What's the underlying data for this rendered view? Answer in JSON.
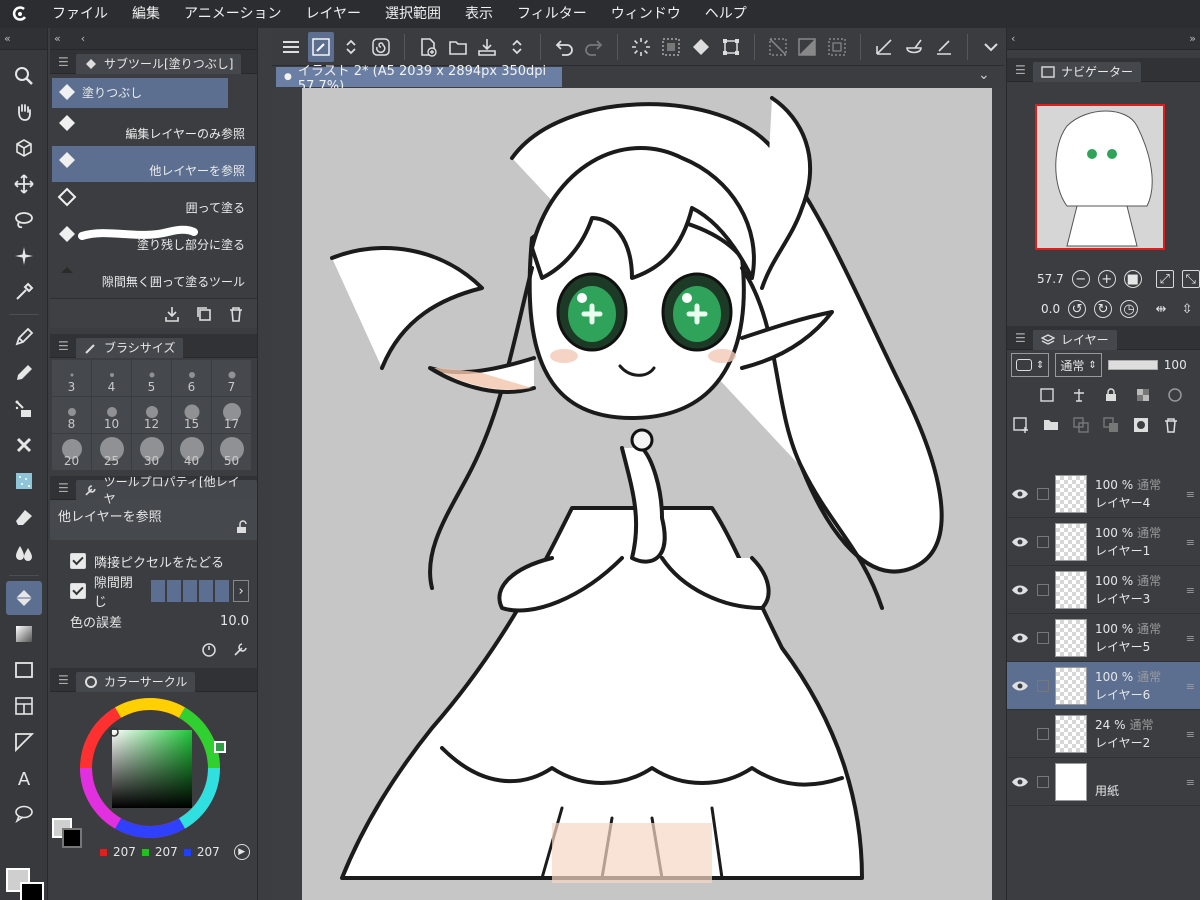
{
  "menu": [
    "ファイル",
    "編集",
    "アニメーション",
    "レイヤー",
    "選択範囲",
    "表示",
    "フィルター",
    "ウィンドウ",
    "ヘルプ"
  ],
  "subtool": {
    "title": "サブツール[塗りつぶし]",
    "items": [
      {
        "label": "塗りつぶし",
        "selected": true
      },
      {
        "label": "編集レイヤーのみ参照",
        "selected": false
      },
      {
        "label": "他レイヤーを参照",
        "selected": true
      },
      {
        "label": "囲って塗る",
        "selected": false
      },
      {
        "label": "塗り残し部分に塗る",
        "selected": false
      },
      {
        "label": "隙間無く囲って塗るツール",
        "selected": false
      }
    ]
  },
  "brush_size": {
    "title": "ブラシサイズ",
    "sizes": [
      "3",
      "4",
      "5",
      "6",
      "7",
      "8",
      "10",
      "12",
      "15",
      "17",
      "20",
      "25",
      "30",
      "40",
      "50"
    ]
  },
  "tool_property": {
    "title": "ツールプロパティ[他レイヤ",
    "preset_name": "他レイヤーを参照",
    "follow_adjacent": "隣接ピクセルをたどる",
    "close_gap": "隙間閉じ",
    "color_margin_label": "色の誤差",
    "color_margin_value": "10.0"
  },
  "color": {
    "title": "カラーサークル",
    "r": "207",
    "g": "207",
    "b": "207",
    "main_color": "#cfcfcf",
    "sub_color": "#000000"
  },
  "document": {
    "tab_label": "イラスト 2* (A5 2039 x 2894px 350dpi 57.7%)"
  },
  "navigator": {
    "title": "ナビゲーター",
    "zoom": "57.7",
    "rotation": "0.0"
  },
  "layers": {
    "title": "レイヤー",
    "blend_mode": "通常",
    "opacity": "100",
    "items": [
      {
        "opacity": "100 %",
        "mode": "通常",
        "name": "レイヤー4",
        "visible": true,
        "selected": false
      },
      {
        "opacity": "100 %",
        "mode": "通常",
        "name": "レイヤー1",
        "visible": true,
        "selected": false
      },
      {
        "opacity": "100 %",
        "mode": "通常",
        "name": "レイヤー3",
        "visible": true,
        "selected": false
      },
      {
        "opacity": "100 %",
        "mode": "通常",
        "name": "レイヤー5",
        "visible": true,
        "selected": false
      },
      {
        "opacity": "100 %",
        "mode": "通常",
        "name": "レイヤー6",
        "visible": true,
        "selected": true
      },
      {
        "opacity": "24 %",
        "mode": "通常",
        "name": "レイヤー2",
        "visible": false,
        "selected": false
      },
      {
        "opacity": "",
        "mode": "",
        "name": "用紙",
        "visible": true,
        "selected": false
      }
    ]
  },
  "accent_color": "#5c6f91"
}
